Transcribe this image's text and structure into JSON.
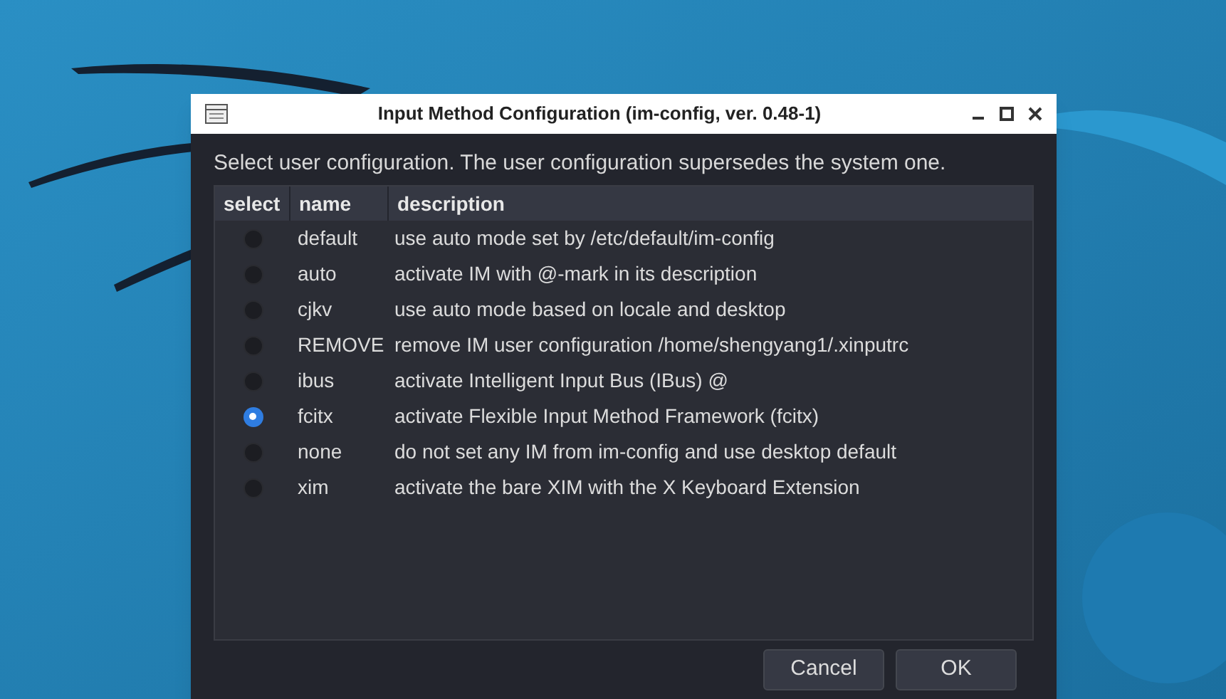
{
  "window": {
    "title": "Input Method Configuration (im-config, ver. 0.48-1)"
  },
  "instruction": "Select user configuration. The user configuration supersedes the system one.",
  "table": {
    "columns": [
      "select",
      "name",
      "description"
    ],
    "rows": [
      {
        "name": "default",
        "description": "use auto mode set by /etc/default/im-config",
        "selected": false
      },
      {
        "name": "auto",
        "description": "activate IM with @-mark in its description",
        "selected": false
      },
      {
        "name": "cjkv",
        "description": "use auto mode based on locale and desktop",
        "selected": false
      },
      {
        "name": "REMOVE",
        "description": "remove IM user configuration /home/shengyang1/.xinputrc",
        "selected": false
      },
      {
        "name": "ibus",
        "description": "activate Intelligent Input Bus (IBus) @",
        "selected": false
      },
      {
        "name": "fcitx",
        "description": "activate Flexible Input Method Framework (fcitx)",
        "selected": true
      },
      {
        "name": "none",
        "description": "do not set any IM from im-config and use desktop default",
        "selected": false
      },
      {
        "name": "xim",
        "description": "activate the bare XIM with the X Keyboard Extension",
        "selected": false
      }
    ]
  },
  "buttons": [
    "Cancel",
    "OK"
  ]
}
